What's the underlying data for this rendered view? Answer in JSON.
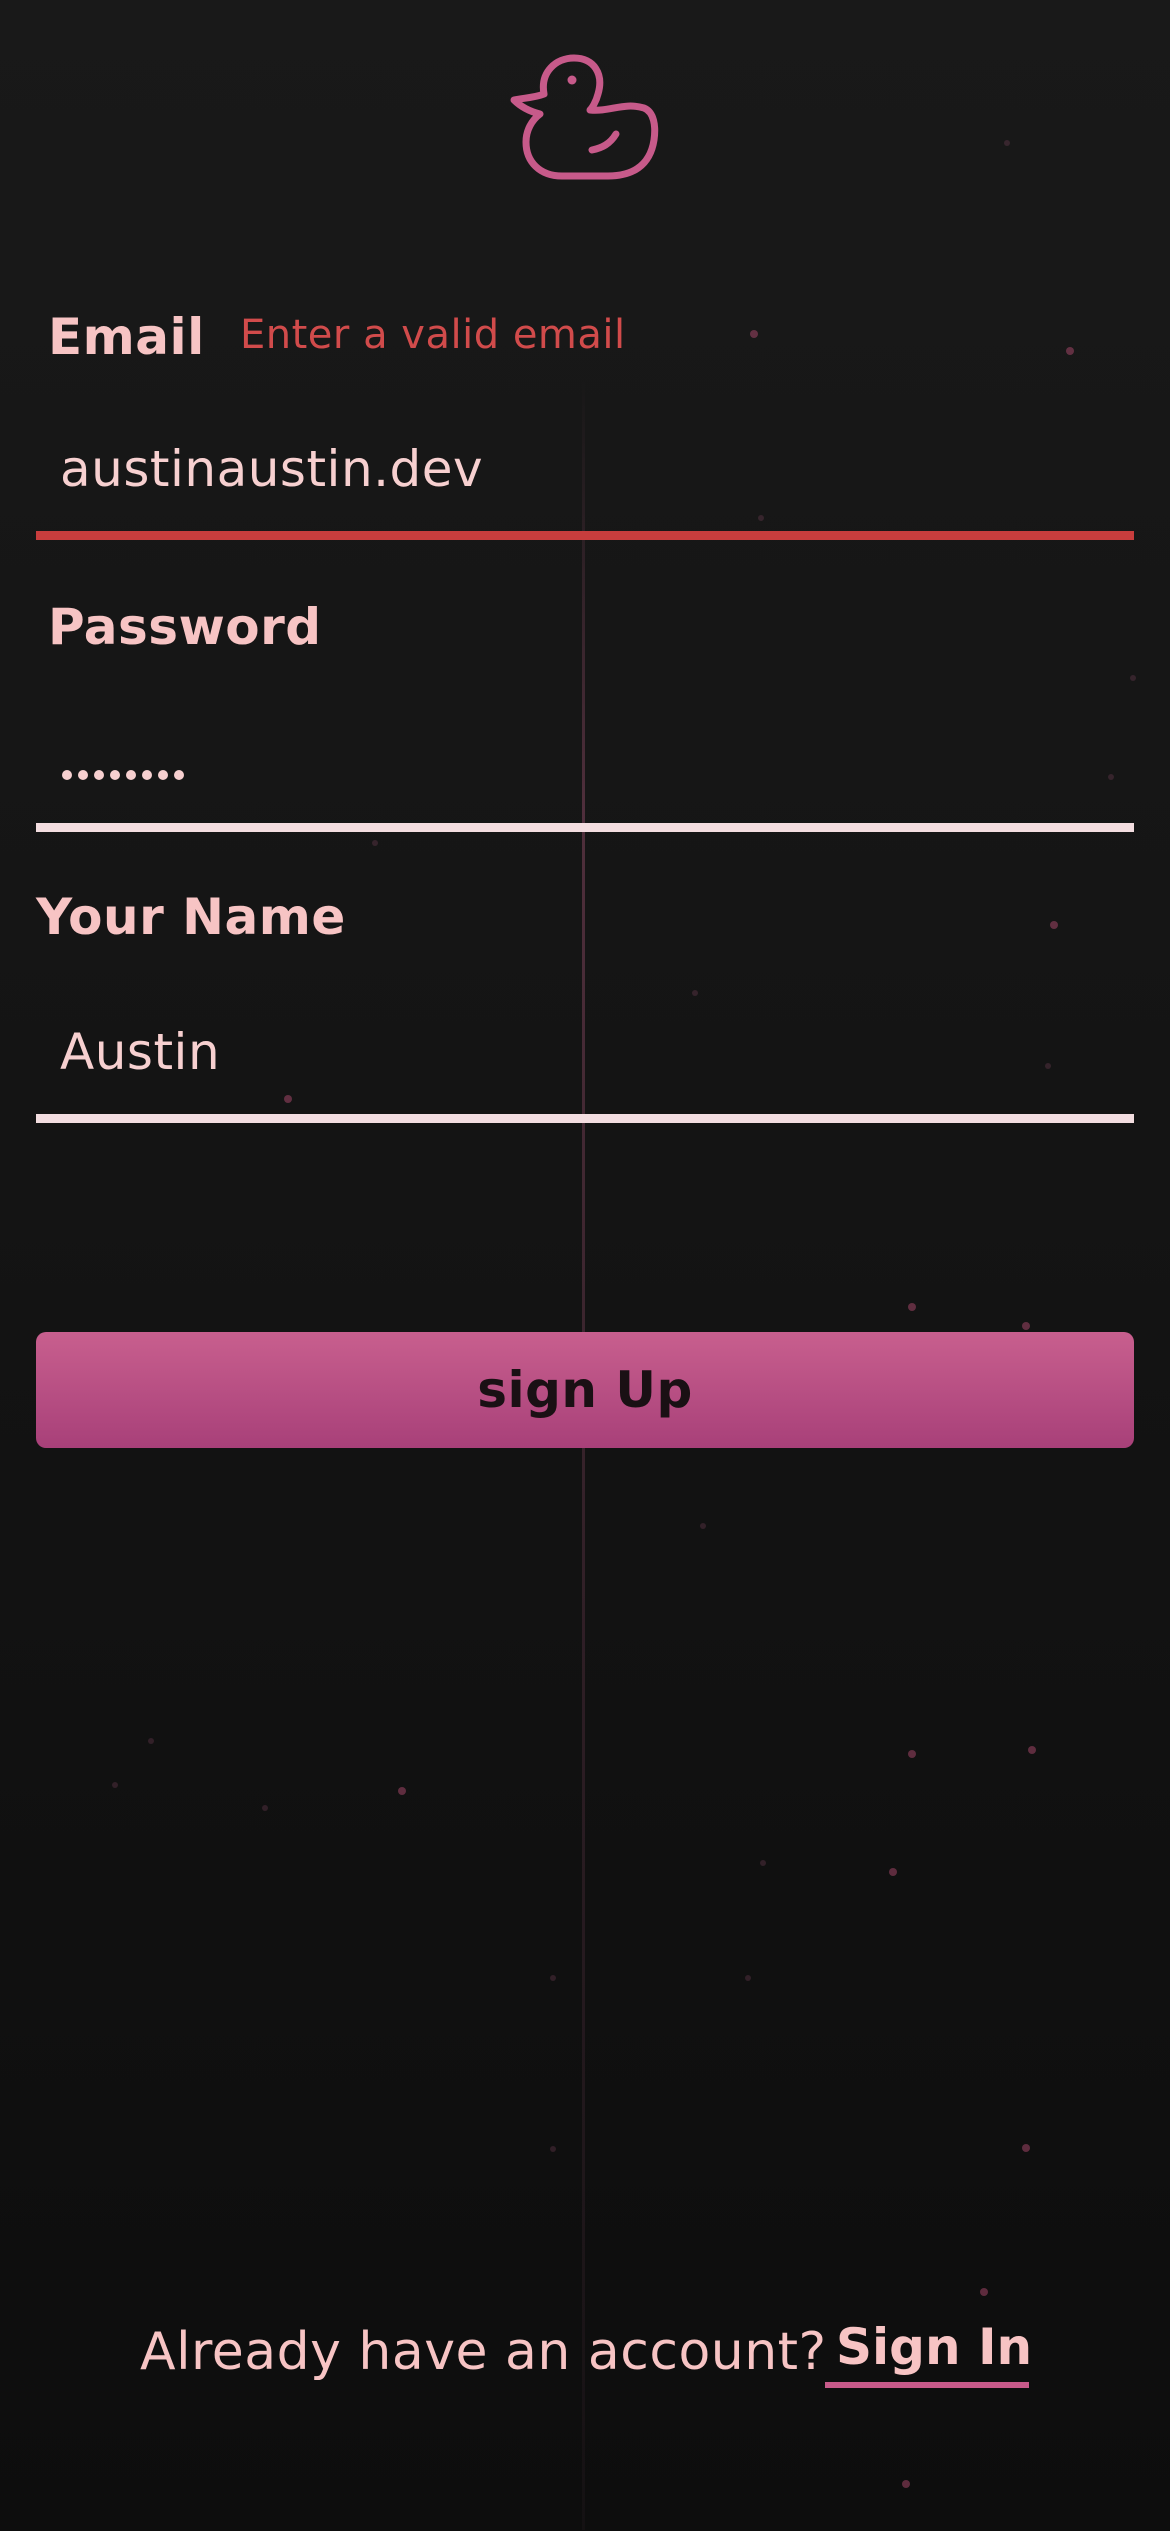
{
  "app": {
    "logo_icon": "duck-icon",
    "accent": "#c75a8a",
    "error_color": "#d14b4b"
  },
  "form": {
    "email": {
      "label": "Email",
      "error": "Enter a valid email",
      "value": "austinaustin.dev"
    },
    "password": {
      "label": "Password",
      "masked_value": "••••••••",
      "length": 8
    },
    "name": {
      "label": "Your Name",
      "value": "Austin"
    },
    "submit_label": "sign Up"
  },
  "footer": {
    "prompt": "Already have an account?",
    "link_label": "Sign In"
  }
}
